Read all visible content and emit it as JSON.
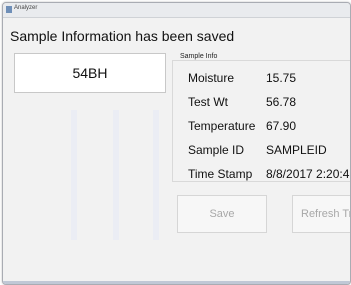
{
  "window": {
    "title": "Analyzer"
  },
  "status": {
    "message": "Sample Information has been saved"
  },
  "sample_button": {
    "label": "54BH"
  },
  "sample_info": {
    "group_title": "Sample Info",
    "rows": [
      {
        "label": "Moisture",
        "value": "15.75"
      },
      {
        "label": "Test Wt",
        "value": "56.78"
      },
      {
        "label": "Temperature",
        "value": "67.90"
      },
      {
        "label": "Sample ID",
        "value": "SAMPLEID"
      },
      {
        "label": "Time Stamp",
        "value": "8/8/2017 2:20:4"
      }
    ]
  },
  "buttons": {
    "save_label": "Save",
    "refresh_label": "Refresh Tr"
  }
}
